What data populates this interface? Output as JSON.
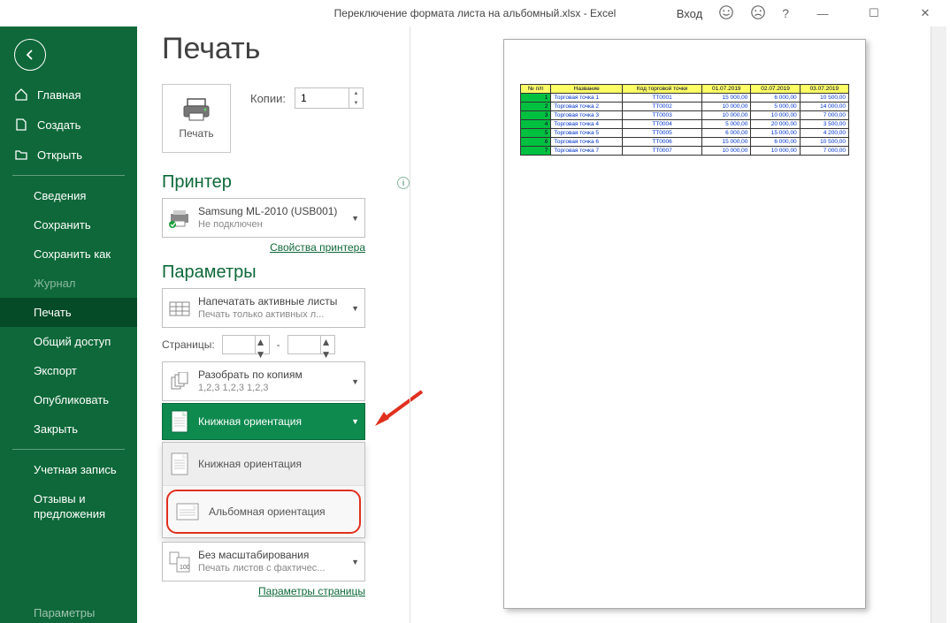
{
  "window": {
    "title": "Переключение формата листа на альбомный.xlsx  -  Excel",
    "login": "Вход"
  },
  "sidebar": {
    "items": [
      {
        "label": "Главная",
        "icon": "home"
      },
      {
        "label": "Создать",
        "icon": "new"
      },
      {
        "label": "Открыть",
        "icon": "open"
      }
    ],
    "sub": [
      {
        "label": "Сведения"
      },
      {
        "label": "Сохранить"
      },
      {
        "label": "Сохранить как"
      },
      {
        "label": "Журнал",
        "disabled": true
      },
      {
        "label": "Печать",
        "active": true
      },
      {
        "label": "Общий доступ"
      },
      {
        "label": "Экспорт"
      },
      {
        "label": "Опубликовать"
      },
      {
        "label": "Закрыть"
      }
    ],
    "bottom": [
      {
        "label": "Учетная запись"
      },
      {
        "label": "Отзывы и предложения"
      },
      {
        "label": "Параметры",
        "faded": true
      }
    ]
  },
  "page": {
    "title": "Печать",
    "print_button": "Печать",
    "copies_label": "Копии:",
    "copies_value": "1",
    "printer_heading": "Принтер",
    "printer_name": "Samsung ML-2010 (USB001)",
    "printer_status": "Не подключен",
    "printer_props": "Свойства принтера",
    "params_heading": "Параметры",
    "opt_active_sheets": "Напечатать активные листы",
    "opt_active_sheets_sub": "Печать только активных л...",
    "pages_label": "Страницы:",
    "pages_sep": "-",
    "opt_collate": "Разобрать по копиям",
    "opt_collate_sub": "1,2,3    1,2,3    1,2,3",
    "opt_orientation": "Книжная ориентация",
    "orientation_portrait": "Книжная ориентация",
    "orientation_landscape": "Альбомная ориентация",
    "opt_scale": "Без масштабирования",
    "opt_scale_sub": "Печать листов с фактичес...",
    "page_setup": "Параметры страницы"
  },
  "preview": {
    "headers": [
      "№ п/п",
      "Название",
      "Код торговой точки",
      "01.07.2019",
      "02.07.2019",
      "03.07.2019"
    ],
    "rows": [
      [
        "1",
        "Торговая точка 1",
        "ТТ0001",
        "15 000,00",
        "6 000,00",
        "10 500,00"
      ],
      [
        "2",
        "Торговая точка 2",
        "ТТ0002",
        "10 000,00",
        "5 000,00",
        "14 000,00"
      ],
      [
        "3",
        "Торговая точка 3",
        "ТТ0003",
        "10 000,00",
        "10 000,00",
        "7 000,00"
      ],
      [
        "4",
        "Торговая точка 4",
        "ТТ0004",
        "5 000,00",
        "20 000,00",
        "3 500,00"
      ],
      [
        "5",
        "Торговая точка 5",
        "ТТ0005",
        "6 000,00",
        "15 000,00",
        "4 200,00"
      ],
      [
        "6",
        "Торговая точка 6",
        "ТТ0006",
        "15 000,00",
        "6 000,00",
        "10 500,00"
      ],
      [
        "7",
        "Торговая точка 7",
        "ТТ0007",
        "10 000,00",
        "10 000,00",
        "7 000,00"
      ]
    ]
  }
}
